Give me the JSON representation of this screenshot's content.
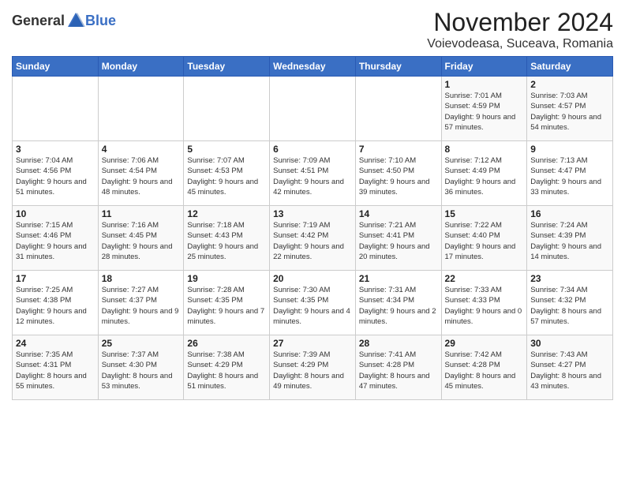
{
  "logo": {
    "general": "General",
    "blue": "Blue"
  },
  "title": {
    "month": "November 2024",
    "location": "Voievodeasa, Suceava, Romania"
  },
  "weekdays": [
    "Sunday",
    "Monday",
    "Tuesday",
    "Wednesday",
    "Thursday",
    "Friday",
    "Saturday"
  ],
  "weeks": [
    [
      {
        "day": "",
        "info": ""
      },
      {
        "day": "",
        "info": ""
      },
      {
        "day": "",
        "info": ""
      },
      {
        "day": "",
        "info": ""
      },
      {
        "day": "",
        "info": ""
      },
      {
        "day": "1",
        "info": "Sunrise: 7:01 AM\nSunset: 4:59 PM\nDaylight: 9 hours and 57 minutes."
      },
      {
        "day": "2",
        "info": "Sunrise: 7:03 AM\nSunset: 4:57 PM\nDaylight: 9 hours and 54 minutes."
      }
    ],
    [
      {
        "day": "3",
        "info": "Sunrise: 7:04 AM\nSunset: 4:56 PM\nDaylight: 9 hours and 51 minutes."
      },
      {
        "day": "4",
        "info": "Sunrise: 7:06 AM\nSunset: 4:54 PM\nDaylight: 9 hours and 48 minutes."
      },
      {
        "day": "5",
        "info": "Sunrise: 7:07 AM\nSunset: 4:53 PM\nDaylight: 9 hours and 45 minutes."
      },
      {
        "day": "6",
        "info": "Sunrise: 7:09 AM\nSunset: 4:51 PM\nDaylight: 9 hours and 42 minutes."
      },
      {
        "day": "7",
        "info": "Sunrise: 7:10 AM\nSunset: 4:50 PM\nDaylight: 9 hours and 39 minutes."
      },
      {
        "day": "8",
        "info": "Sunrise: 7:12 AM\nSunset: 4:49 PM\nDaylight: 9 hours and 36 minutes."
      },
      {
        "day": "9",
        "info": "Sunrise: 7:13 AM\nSunset: 4:47 PM\nDaylight: 9 hours and 33 minutes."
      }
    ],
    [
      {
        "day": "10",
        "info": "Sunrise: 7:15 AM\nSunset: 4:46 PM\nDaylight: 9 hours and 31 minutes."
      },
      {
        "day": "11",
        "info": "Sunrise: 7:16 AM\nSunset: 4:45 PM\nDaylight: 9 hours and 28 minutes."
      },
      {
        "day": "12",
        "info": "Sunrise: 7:18 AM\nSunset: 4:43 PM\nDaylight: 9 hours and 25 minutes."
      },
      {
        "day": "13",
        "info": "Sunrise: 7:19 AM\nSunset: 4:42 PM\nDaylight: 9 hours and 22 minutes."
      },
      {
        "day": "14",
        "info": "Sunrise: 7:21 AM\nSunset: 4:41 PM\nDaylight: 9 hours and 20 minutes."
      },
      {
        "day": "15",
        "info": "Sunrise: 7:22 AM\nSunset: 4:40 PM\nDaylight: 9 hours and 17 minutes."
      },
      {
        "day": "16",
        "info": "Sunrise: 7:24 AM\nSunset: 4:39 PM\nDaylight: 9 hours and 14 minutes."
      }
    ],
    [
      {
        "day": "17",
        "info": "Sunrise: 7:25 AM\nSunset: 4:38 PM\nDaylight: 9 hours and 12 minutes."
      },
      {
        "day": "18",
        "info": "Sunrise: 7:27 AM\nSunset: 4:37 PM\nDaylight: 9 hours and 9 minutes."
      },
      {
        "day": "19",
        "info": "Sunrise: 7:28 AM\nSunset: 4:35 PM\nDaylight: 9 hours and 7 minutes."
      },
      {
        "day": "20",
        "info": "Sunrise: 7:30 AM\nSunset: 4:35 PM\nDaylight: 9 hours and 4 minutes."
      },
      {
        "day": "21",
        "info": "Sunrise: 7:31 AM\nSunset: 4:34 PM\nDaylight: 9 hours and 2 minutes."
      },
      {
        "day": "22",
        "info": "Sunrise: 7:33 AM\nSunset: 4:33 PM\nDaylight: 9 hours and 0 minutes."
      },
      {
        "day": "23",
        "info": "Sunrise: 7:34 AM\nSunset: 4:32 PM\nDaylight: 8 hours and 57 minutes."
      }
    ],
    [
      {
        "day": "24",
        "info": "Sunrise: 7:35 AM\nSunset: 4:31 PM\nDaylight: 8 hours and 55 minutes."
      },
      {
        "day": "25",
        "info": "Sunrise: 7:37 AM\nSunset: 4:30 PM\nDaylight: 8 hours and 53 minutes."
      },
      {
        "day": "26",
        "info": "Sunrise: 7:38 AM\nSunset: 4:29 PM\nDaylight: 8 hours and 51 minutes."
      },
      {
        "day": "27",
        "info": "Sunrise: 7:39 AM\nSunset: 4:29 PM\nDaylight: 8 hours and 49 minutes."
      },
      {
        "day": "28",
        "info": "Sunrise: 7:41 AM\nSunset: 4:28 PM\nDaylight: 8 hours and 47 minutes."
      },
      {
        "day": "29",
        "info": "Sunrise: 7:42 AM\nSunset: 4:28 PM\nDaylight: 8 hours and 45 minutes."
      },
      {
        "day": "30",
        "info": "Sunrise: 7:43 AM\nSunset: 4:27 PM\nDaylight: 8 hours and 43 minutes."
      }
    ]
  ]
}
